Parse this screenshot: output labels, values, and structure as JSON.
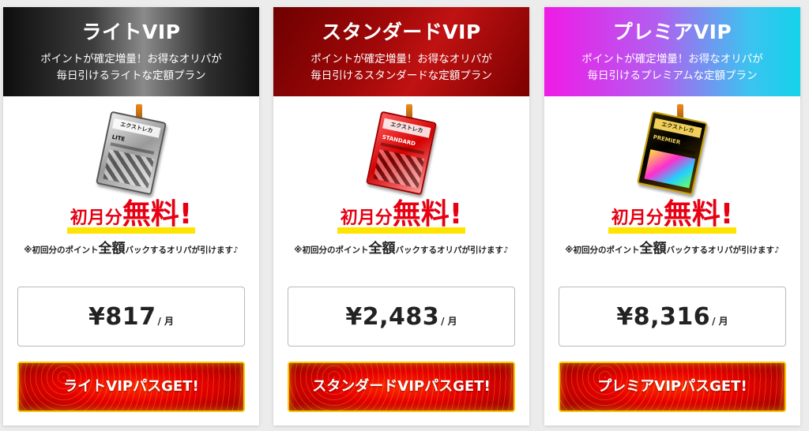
{
  "plans": [
    {
      "title": "ライトVIP",
      "desc_line1": "ポイントが確定増量！お得なオリパが",
      "desc_line2": "毎日引けるライトな定額プラン",
      "pass_logo": "エクストレカ",
      "pass_tier": "LITE",
      "free_small": "初月分",
      "free_big": "無料!",
      "note_pre": "※初回分のポイント",
      "note_strong": "全額",
      "note_post": "バックするオリパが引けます♪",
      "price": "¥817",
      "per": "/ 月",
      "cta": "ライトVIPパスGET!"
    },
    {
      "title": "スタンダードVIP",
      "desc_line1": "ポイントが確定増量！お得なオリパが",
      "desc_line2": "毎日引けるスタンダードな定額プラン",
      "pass_logo": "エクストレカ",
      "pass_tier": "STANDARD",
      "free_small": "初月分",
      "free_big": "無料!",
      "note_pre": "※初回分のポイント",
      "note_strong": "全額",
      "note_post": "バックするオリパが引けます♪",
      "price": "¥2,483",
      "per": "/ 月",
      "cta": "スタンダードVIPパスGET!"
    },
    {
      "title": "プレミアVIP",
      "desc_line1": "ポイントが確定増量！お得なオリパが",
      "desc_line2": "毎日引けるプレミアムな定額プラン",
      "pass_logo": "エクストレカ",
      "pass_tier": "PREMIER",
      "free_small": "初月分",
      "free_big": "無料!",
      "note_pre": "※初回分のポイント",
      "note_strong": "全額",
      "note_post": "バックするオリパが引けます♪",
      "price": "¥8,316",
      "per": "/ 月",
      "cta": "プレミアVIPパスGET!"
    }
  ],
  "colors": {
    "accent_red": "#e60012",
    "highlight_yellow": "#ffe400",
    "cta_border": "#f6c800"
  }
}
